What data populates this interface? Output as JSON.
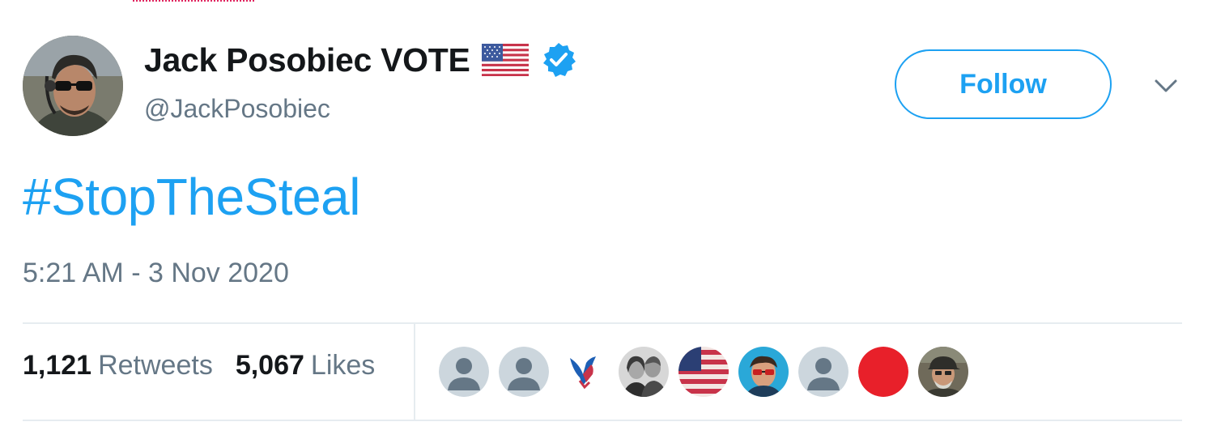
{
  "tweet": {
    "author": {
      "display_name": "Jack Posobiec VOTE",
      "handle": "@JackPosobiec",
      "flag_icon": "us-flag-icon",
      "verified_icon": "verified-badge-icon",
      "verified_color": "#1da1f2"
    },
    "follow_label": "Follow",
    "menu_icon": "chevron-down-icon",
    "text": "#StopTheSteal",
    "timestamp": "5:21 AM - 3 Nov 2020",
    "stats": {
      "retweets_count": "1,121",
      "retweets_label": "Retweets",
      "likes_count": "5,067",
      "likes_label": "Likes"
    },
    "likers": [
      "default-avatar-icon",
      "default-avatar-icon",
      "eagle-logo-avatar",
      "couple-photo-avatar",
      "flag-avatar",
      "sunglasses-avatar",
      "default-avatar-icon",
      "red-circle-avatar",
      "cap-man-avatar"
    ]
  },
  "colors": {
    "accent": "#1da1f2",
    "text_primary": "#14171a",
    "text_secondary": "#657786",
    "divider": "#e6ecf0"
  }
}
